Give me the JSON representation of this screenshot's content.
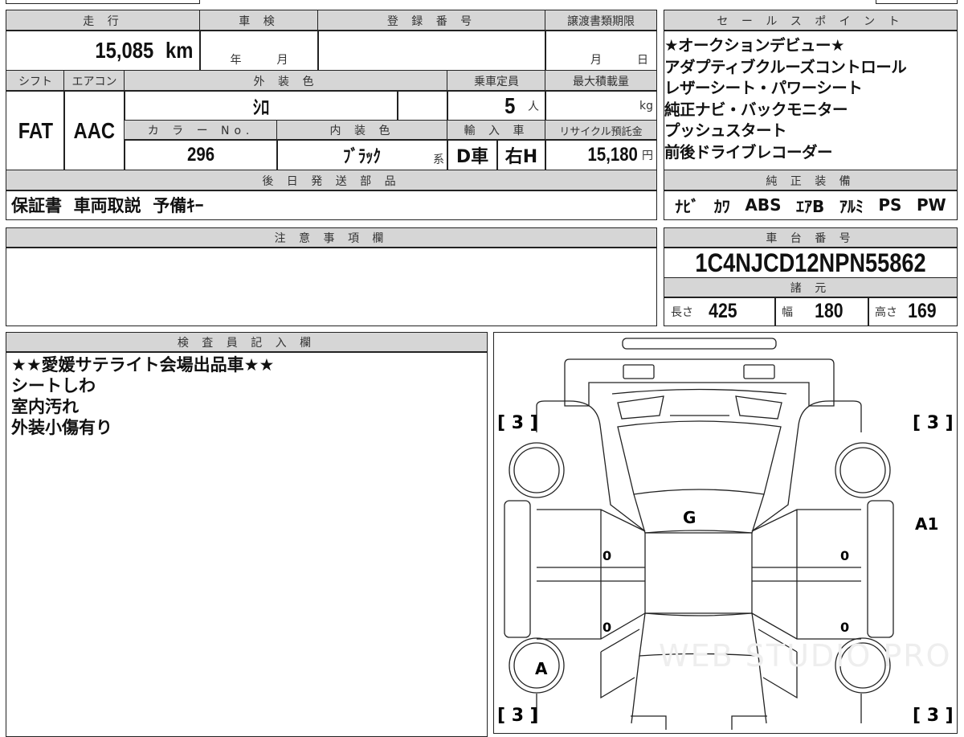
{
  "headers": {
    "mileage": "走 行",
    "inspection": "車 検",
    "registration": "登 録 番 号",
    "transfer_deadline": "譲渡書類期限",
    "shift": "シフト",
    "aircon": "エアコン",
    "exterior_color": "外 装 色",
    "capacity": "乗車定員",
    "max_load": "最大積載量",
    "color_no": "カ ラ ー No.",
    "interior_color": "内 装 色",
    "import": "輸 入 車",
    "recycle": "リサイクル預託金",
    "later_parts": "後 日 発 送 部 品",
    "sales_points": "セ ー ル ス ポ イ ン ト",
    "equipment": "純 正 装 備",
    "notes": "注 意 事 項 欄",
    "chassis": "車 台 番 号",
    "specs": "諸 元",
    "inspector": "検 査 員 記 入 欄"
  },
  "values": {
    "mileage": "15,085",
    "mileage_unit": "km",
    "year_label": "年",
    "month_label": "月",
    "deadline_month": "月",
    "deadline_day": "日",
    "shift": "FAT",
    "aircon": "AAC",
    "exterior_color": "ｼﾛ",
    "capacity": "5",
    "capacity_unit": "人",
    "max_load_unit": "kg",
    "color_no": "296",
    "interior_color": "ﾌﾞﾗｯｸ",
    "interior_suffix": "系",
    "import_type": "D車",
    "steering": "右H",
    "recycle": "15,180",
    "recycle_unit": "円",
    "later_parts": "保証書  車両取説  予備ｷｰ"
  },
  "sales_points": [
    "★オークションデビュー★",
    "アダプティブクルーズコントロール",
    "レザーシート・パワーシート",
    "純正ナビ・バックモニター",
    "プッシュスタート",
    "前後ドライブレコーダー"
  ],
  "equipment": [
    "ﾅﾋﾞ",
    "ｶﾜ",
    "ABS",
    "ｴｱB",
    "ｱﾙﾐ",
    "PS",
    "PW"
  ],
  "chassis_no": "1C4NJCD12NPN55862",
  "specs": {
    "length_label": "長さ",
    "length": "425",
    "width_label": "幅",
    "width": "180",
    "height_label": "高さ",
    "height": "169"
  },
  "inspector_notes": [
    "★★愛媛サテライト会場出品車★★",
    "シートしわ",
    "室内汚れ",
    "外装小傷有り"
  ],
  "diagram": {
    "corner_fl": "[ 3 ]",
    "corner_fr": "[ 3 ]",
    "corner_rl": "[ 3 ]",
    "corner_rr": "[ 3 ]",
    "roof": "G",
    "right_panel": "A1",
    "rear_left_wheel": "A",
    "door_fl": "0",
    "door_rl": "0",
    "door_fr": "0",
    "door_rr": "0",
    "watermark": "WEB STUDIO PRO"
  }
}
